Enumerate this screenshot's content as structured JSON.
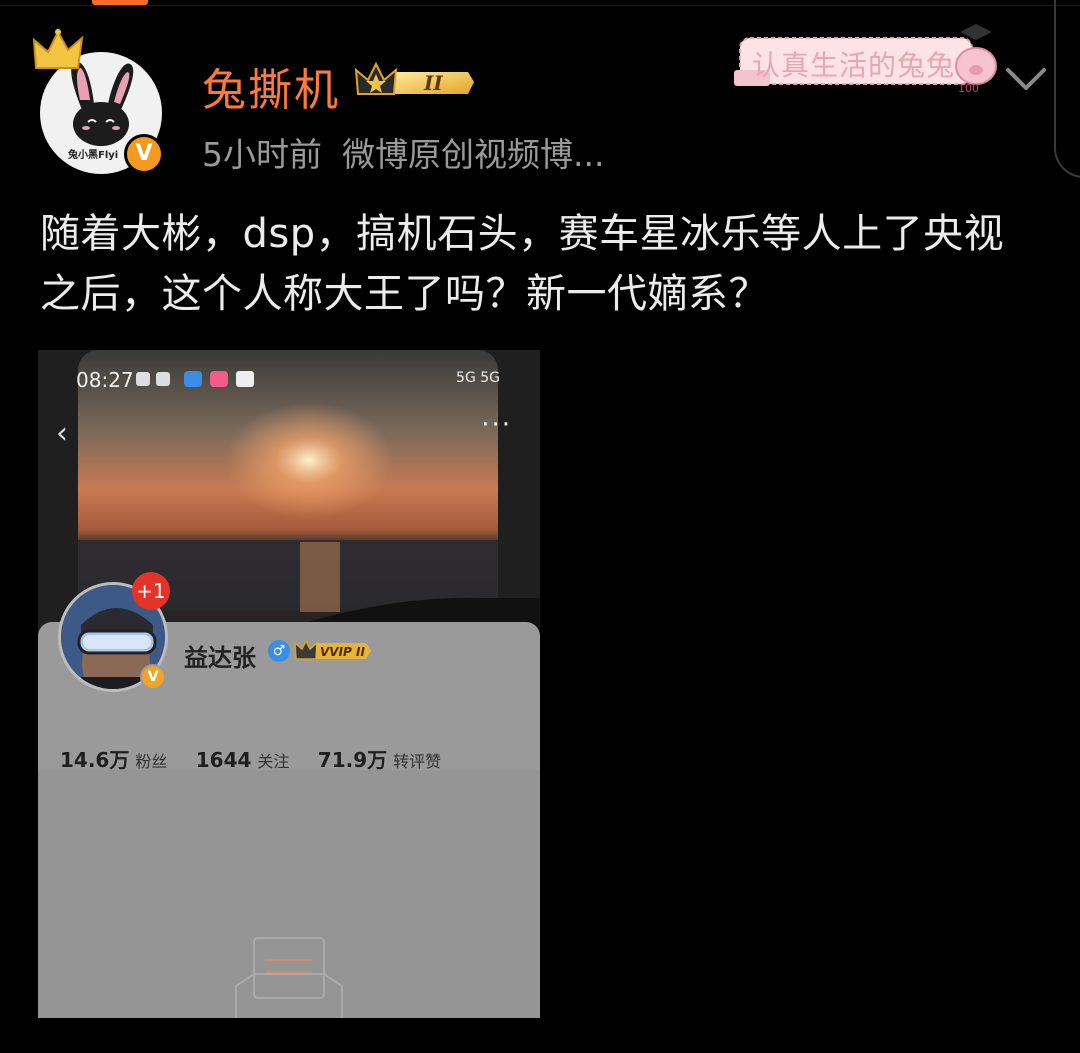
{
  "post": {
    "username": "兔撕机",
    "timestamp": "5小时前",
    "source": "微博原创视频博...",
    "avatar_text": "兔小黑Flyi",
    "verified_mark": "V",
    "vip_level": "II",
    "decoration_text": "认真生活的兔兔",
    "decoration_score": "100",
    "content": "随着大彬，dsp，搞机石头，赛车星冰乐等人上了央视之后，这个人称大王了吗？新一代嫡系？"
  },
  "embedded_screenshot": {
    "status_time": "08:27",
    "status_right": "5G 5G",
    "back_glyph": "‹",
    "more_glyph": "···",
    "notification_count": "+1",
    "profile": {
      "name": "益达张",
      "gender_glyph": "♂",
      "vip_label": "VVIP II",
      "verified_mark": "V"
    },
    "stats": [
      {
        "value": "14.6万",
        "label": "粉丝"
      },
      {
        "value": "1644",
        "label": "关注"
      },
      {
        "value": "71.9万",
        "label": "转评赞"
      }
    ]
  },
  "colors": {
    "username": "#ff7a3a",
    "meta": "#9a9a9a",
    "accent_orange": "#ff6a2b",
    "verified": "#f59a1b"
  },
  "icons": [
    "crown-icon",
    "rabbit-avatar",
    "verified-icon",
    "vip-badge-icon",
    "chevron-down-icon",
    "back-arrow-icon",
    "more-icon",
    "gender-male-icon"
  ]
}
